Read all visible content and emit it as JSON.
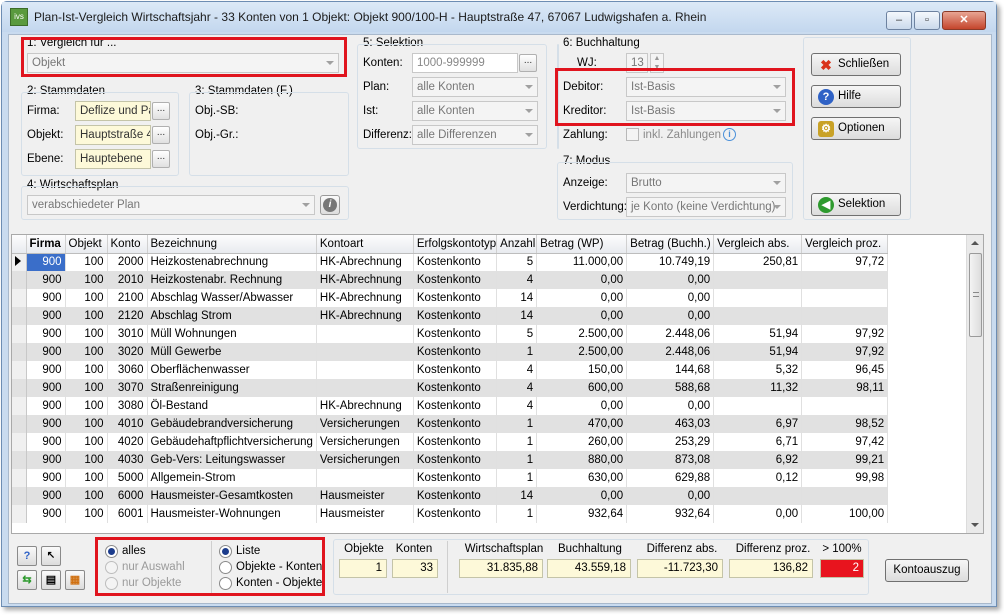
{
  "window": {
    "title": "Plan-Ist-Vergleich Wirtschaftsjahr - 33 Konten von 1 Objekt:  Objekt 900/100-H - Hauptstraße 47, 67067 Ludwigshafen a. Rhein",
    "app_icon_text": "ivs"
  },
  "vergleich": {
    "label": "1: Vergleich für ...",
    "value": "Objekt"
  },
  "stammdaten": {
    "label": "2: Stammdaten",
    "firma_label": "Firma:",
    "firma_value": "Deflize und Par",
    "objekt_label": "Objekt:",
    "objekt_value": "Hauptstraße 47",
    "ebene_label": "Ebene:",
    "ebene_value": "Hauptebene",
    "dots": "..."
  },
  "stammdaten_f": {
    "label": "3: Stammdaten (F.)",
    "objsb_label": "Obj.-SB:",
    "objgr_label": "Obj.-Gr.:"
  },
  "wirtschaftsplan": {
    "label": "4: Wirtschaftsplan",
    "value": "verabschiedeter Plan"
  },
  "selektion": {
    "label": "5: Selektion",
    "konten_label": "Konten:",
    "konten_value": "1000-999999",
    "plan_label": "Plan:",
    "plan_value": "alle Konten",
    "ist_label": "Ist:",
    "ist_value": "alle Konten",
    "differenz_label": "Differenz:",
    "differenz_value": "alle Differenzen"
  },
  "buchhaltung": {
    "label": "6: Buchhaltung",
    "wj_label": "WJ:",
    "wj_value": "13",
    "debitor_label": "Debitor:",
    "debitor_value": "Ist-Basis",
    "kreditor_label": "Kreditor:",
    "kreditor_value": "Ist-Basis",
    "zahlung_label": "Zahlung:",
    "zahlung_check_label": "inkl. Zahlungen"
  },
  "modus": {
    "label": "7: Modus",
    "anzeige_label": "Anzeige:",
    "anzeige_value": "Brutto",
    "verdichtung_label": "Verdichtung:",
    "verdichtung_value": "je Konto (keine Verdichtung)"
  },
  "buttons": {
    "schliessen": "Schließen",
    "hilfe": "Hilfe",
    "optionen": "Optionen",
    "selektion": "Selektion",
    "kontoauszug": "Kontoauszug"
  },
  "table": {
    "columns": [
      "Firma",
      "Objekt",
      "Konto",
      "Bezeichnung",
      "Kontoart",
      "Erfolgskontotyp",
      "Anzahl",
      "Betrag (WP)",
      "Betrag (Buchh.)",
      "Vergleich abs.",
      "Vergleich proz."
    ],
    "rows": [
      [
        "900",
        "100",
        "2000",
        "Heizkostenabrechnung",
        "HK-Abrechnung",
        "Kostenkonto",
        "5",
        "11.000,00",
        "10.749,19",
        "250,81",
        "97,72"
      ],
      [
        "900",
        "100",
        "2010",
        "Heizkostenabr. Rechnung",
        "HK-Abrechnung",
        "Kostenkonto",
        "4",
        "0,00",
        "0,00",
        "",
        ""
      ],
      [
        "900",
        "100",
        "2100",
        "Abschlag Wasser/Abwasser",
        "HK-Abrechnung",
        "Kostenkonto",
        "14",
        "0,00",
        "0,00",
        "",
        ""
      ],
      [
        "900",
        "100",
        "2120",
        "Abschlag Strom",
        "HK-Abrechnung",
        "Kostenkonto",
        "14",
        "0,00",
        "0,00",
        "",
        ""
      ],
      [
        "900",
        "100",
        "3010",
        "Müll Wohnungen",
        "",
        "Kostenkonto",
        "5",
        "2.500,00",
        "2.448,06",
        "51,94",
        "97,92"
      ],
      [
        "900",
        "100",
        "3020",
        "Müll Gewerbe",
        "",
        "Kostenkonto",
        "1",
        "2.500,00",
        "2.448,06",
        "51,94",
        "97,92"
      ],
      [
        "900",
        "100",
        "3060",
        "Oberflächenwasser",
        "",
        "Kostenkonto",
        "4",
        "150,00",
        "144,68",
        "5,32",
        "96,45"
      ],
      [
        "900",
        "100",
        "3070",
        "Straßenreinigung",
        "",
        "Kostenkonto",
        "4",
        "600,00",
        "588,68",
        "11,32",
        "98,11"
      ],
      [
        "900",
        "100",
        "3080",
        "Öl-Bestand",
        "HK-Abrechnung",
        "Kostenkonto",
        "4",
        "0,00",
        "0,00",
        "",
        ""
      ],
      [
        "900",
        "100",
        "4010",
        "Gebäudebrandversicherung",
        "Versicherungen",
        "Kostenkonto",
        "1",
        "470,00",
        "463,03",
        "6,97",
        "98,52"
      ],
      [
        "900",
        "100",
        "4020",
        "Gebäudehaftpflichtversicherung",
        "Versicherungen",
        "Kostenkonto",
        "1",
        "260,00",
        "253,29",
        "6,71",
        "97,42"
      ],
      [
        "900",
        "100",
        "4030",
        "Geb-Vers: Leitungswasser",
        "Versicherungen",
        "Kostenkonto",
        "1",
        "880,00",
        "873,08",
        "6,92",
        "99,21"
      ],
      [
        "900",
        "100",
        "5000",
        "Allgemein-Strom",
        "",
        "Kostenkonto",
        "1",
        "630,00",
        "629,88",
        "0,12",
        "99,98"
      ],
      [
        "900",
        "100",
        "6000",
        "Hausmeister-Gesamtkosten",
        "Hausmeister",
        "Kostenkonto",
        "14",
        "0,00",
        "0,00",
        "",
        ""
      ],
      [
        "900",
        "100",
        "6001",
        "Hausmeister-Wohnungen",
        "Hausmeister",
        "Kostenkonto",
        "1",
        "932,64",
        "932,64",
        "0,00",
        "100,00"
      ]
    ]
  },
  "filter": {
    "alles": "alles",
    "nur_auswahl": "nur Auswahl",
    "nur_objekte": "nur Objekte",
    "liste": "Liste",
    "objekte_konten": "Objekte - Konten",
    "konten_objekte": "Konten - Objekte"
  },
  "summary": {
    "objekte_label": "Objekte",
    "objekte_value": "1",
    "konten_label": "Konten",
    "konten_value": "33",
    "wp_label": "Wirtschaftsplan",
    "wp_value": "31.835,88",
    "bh_label": "Buchhaltung",
    "bh_value": "43.559,18",
    "diffabs_label": "Differenz abs.",
    "diffabs_value": "-11.723,30",
    "diffproz_label": "Differenz proz.",
    "diffproz_value": "136,82",
    "over_label": "> 100%",
    "over_value": "2"
  },
  "colors": {
    "highlight": "#e0141e",
    "selection": "#3a6ec9",
    "over_bg": "#e8141e"
  }
}
